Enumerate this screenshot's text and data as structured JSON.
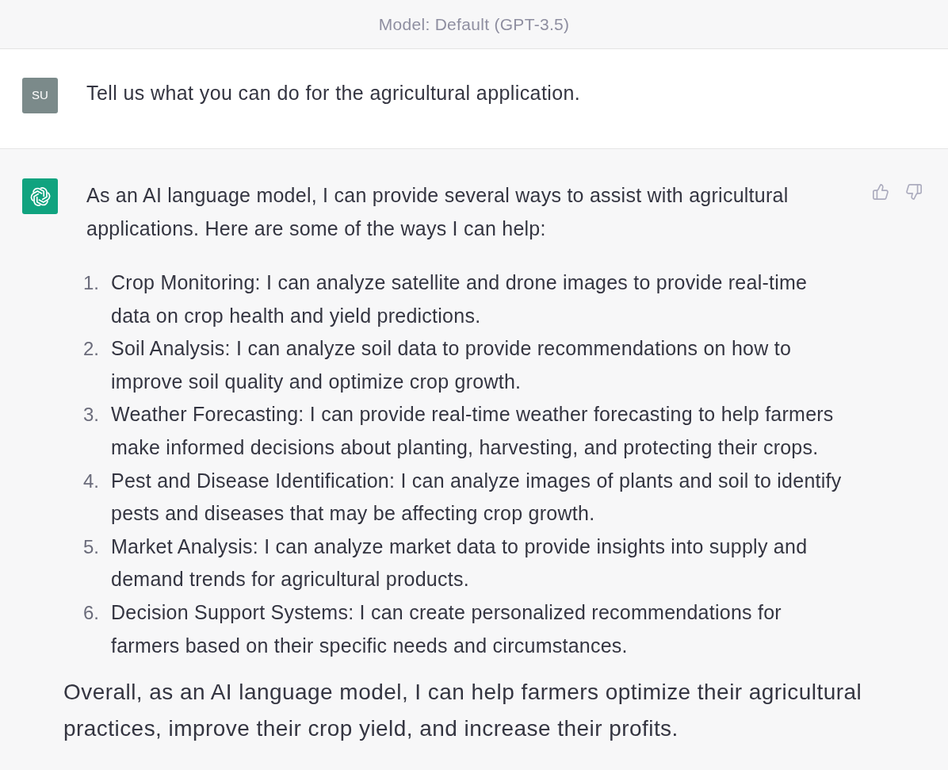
{
  "header": {
    "model_label": "Model: Default (GPT-3.5)"
  },
  "messages": [
    {
      "kind": "user",
      "avatar_text": "SU",
      "text": "Tell us what you can do for the agricultural application."
    },
    {
      "kind": "assistant",
      "intro": "As an AI language model, I can provide several ways to assist with agricultural applications. Here are some of the ways I can help:",
      "items": [
        {
          "number": "1.",
          "text": "Crop Monitoring: I can analyze satellite and drone images to provide real-time data on crop health and yield predictions."
        },
        {
          "number": "2.",
          "text": "Soil Analysis: I can analyze soil data to provide recommendations on how to improve soil quality and optimize crop growth."
        },
        {
          "number": "3.",
          "text": "Weather Forecasting: I can provide real-time weather forecasting to help farmers make informed decisions about planting, harvesting, and protecting their crops."
        },
        {
          "number": "4.",
          "text": "Pest and Disease Identification: I can analyze images of plants and soil to identify pests and diseases that may be affecting crop growth."
        },
        {
          "number": "5.",
          "text": "Market Analysis: I can analyze market data to provide insights into supply and demand trends for agricultural products."
        },
        {
          "number": "6.",
          "text": "Decision Support Systems: I can create personalized recommendations for farmers based on their specific needs and circumstances."
        }
      ],
      "conclusion": "Overall, as an AI language model, I can help farmers optimize their agricultural practices, improve their crop yield, and increase their profits."
    }
  ]
}
